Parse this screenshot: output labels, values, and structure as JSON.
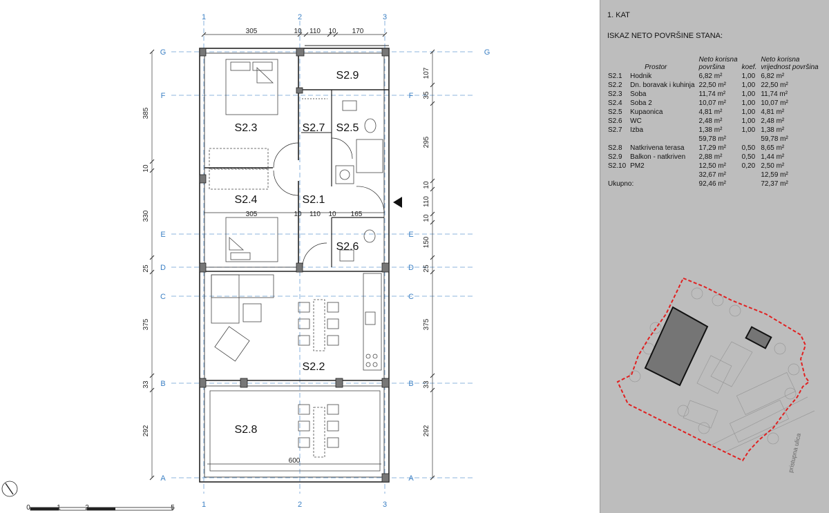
{
  "floor_title": "1. KAT",
  "table_title": "ISKAZ NETO POVRŠINE STANA:",
  "headers": {
    "prostor": "Prostor",
    "net_area_1": "Neto korisna",
    "net_area_2": "površina",
    "coef": "koef.",
    "net_value_1": "Neto korisna",
    "net_value_2": "vrijednost površina"
  },
  "rooms_group1": [
    {
      "code": "S2.1",
      "name": "Hodnik",
      "area": "6,82 m²",
      "coef": "1,00",
      "value": "6,82 m²"
    },
    {
      "code": "S2.2",
      "name": "Dn. boravak i kuhinja",
      "area": "22,50 m²",
      "coef": "1,00",
      "value": "22,50 m²"
    },
    {
      "code": "S2.3",
      "name": "Soba",
      "area": "11,74 m²",
      "coef": "1,00",
      "value": "11,74 m²"
    },
    {
      "code": "S2.4",
      "name": "Soba 2",
      "area": "10,07 m²",
      "coef": "1,00",
      "value": "10,07 m²"
    },
    {
      "code": "S2.5",
      "name": "Kupaonica",
      "area": "4,81 m²",
      "coef": "1,00",
      "value": "4,81 m²"
    },
    {
      "code": "S2.6",
      "name": "WC",
      "area": "2,48 m²",
      "coef": "1,00",
      "value": "2,48 m²"
    },
    {
      "code": "S2.7",
      "name": "Izba",
      "area": "1,38 m²",
      "coef": "1,00",
      "value": "1,38 m²"
    }
  ],
  "subtotal1": {
    "area": "59,78 m²",
    "value": "59,78 m²"
  },
  "rooms_group2": [
    {
      "code": "S2.8",
      "name": "Natkrivena terasa",
      "area": "17,29 m²",
      "coef": "0,50",
      "value": "8,65 m²"
    },
    {
      "code": "S2.9",
      "name": "Balkon - natkriven",
      "area": "2,88 m²",
      "coef": "0,50",
      "value": "1,44 m²"
    },
    {
      "code": "S2.10",
      "name": "PM2",
      "area": "12,50 m²",
      "coef": "0,20",
      "value": "2,50 m²"
    }
  ],
  "subtotal2": {
    "area": "32,67 m²",
    "value": "12,59 m²"
  },
  "total": {
    "label": "Ukupno:",
    "area": "92,46 m²",
    "value": "72,37 m²"
  },
  "site_street_label": "pristupna ulica",
  "plan": {
    "room_labels": [
      "S2.9",
      "S2.3",
      "S2.7",
      "S2.5",
      "S2.4",
      "S2.1",
      "S2.6",
      "S2.2",
      "S2.8"
    ],
    "column_axes": [
      "1",
      "2",
      "3"
    ],
    "row_axes": [
      "G",
      "F",
      "E",
      "D",
      "C",
      "B",
      "A"
    ],
    "top_dims": [
      "305",
      "10",
      "110",
      "10",
      "170"
    ],
    "mid_dims": [
      "305",
      "10",
      "110",
      "10",
      "165"
    ],
    "bottom_dim": "600",
    "left_dims": [
      "385",
      "10",
      "330",
      "25",
      "375",
      "33",
      "292"
    ],
    "right_dims": [
      "107",
      "35",
      "295",
      "10",
      "110",
      "10",
      "150",
      "25",
      "375",
      "33",
      "292"
    ],
    "scale_labels": [
      "0",
      "1",
      "2",
      "5"
    ]
  }
}
